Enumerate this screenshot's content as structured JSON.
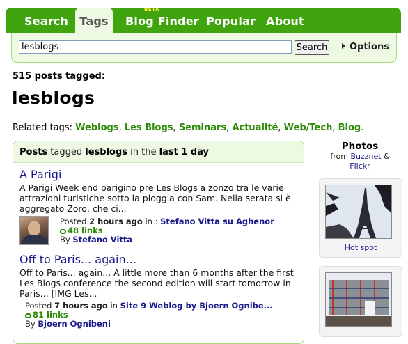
{
  "nav": {
    "tabs": [
      {
        "label": "Search"
      },
      {
        "label": "Tags"
      },
      {
        "label": "Blog Finder",
        "badge": "BETA"
      },
      {
        "label": "Popular"
      },
      {
        "label": "About"
      }
    ]
  },
  "search": {
    "value": "lesblogs",
    "button": "Search",
    "options": "Options"
  },
  "tag": {
    "count_text": "515 posts tagged:",
    "name": "lesblogs"
  },
  "related": {
    "label": "Related tags:",
    "tags": [
      "Weblogs",
      "Les Blogs",
      "Seminars",
      "Actualité",
      "Web/Tech",
      "Blog"
    ]
  },
  "posts_header": {
    "p1": "Posts",
    "p2": " tagged ",
    "p3": "lesblogs",
    "p4": " in the ",
    "p5": "last 1 day"
  },
  "posts": [
    {
      "title": "A Parigi",
      "excerpt": "A Parigi Week end parigino pre Les Blogs a zonzo tra le varie attrazioni turistiche sotto la pioggia con Sam. Nella serata si è aggregato Zoro, che ci...",
      "posted_prefix": "Posted",
      "age": "2 hours ago",
      "in_text": " in : ",
      "source": "Stefano Vitta su Aghenor",
      "links": "48 links",
      "by_prefix": "By",
      "author": "Stefano Vitta"
    },
    {
      "title": "Off to Paris... again...",
      "excerpt": "Off to Paris... again... A little more than 6 months after the first Les Blogs conference the second edition will start tomorrow in Paris... [IMG Les...",
      "posted_prefix": "Posted",
      "age": "7 hours ago",
      "in_text": " in ",
      "source": "Site 9 Weblog by Bjoern Ognibe...",
      "links": "81 links",
      "by_prefix": "By",
      "author": "Bjoern Ognibeni"
    }
  ],
  "photos": {
    "title": "Photos",
    "from": "from",
    "sources": [
      "Buzznet",
      "Flickr"
    ],
    "amp": "&",
    "items": [
      {
        "caption": "Hot spot"
      }
    ]
  },
  "colors": {
    "brand_green": "#3fa40e",
    "tab_active_bg": "#eef9e3",
    "link_blue": "#1a1a8c",
    "tag_green": "#2d8a06"
  }
}
